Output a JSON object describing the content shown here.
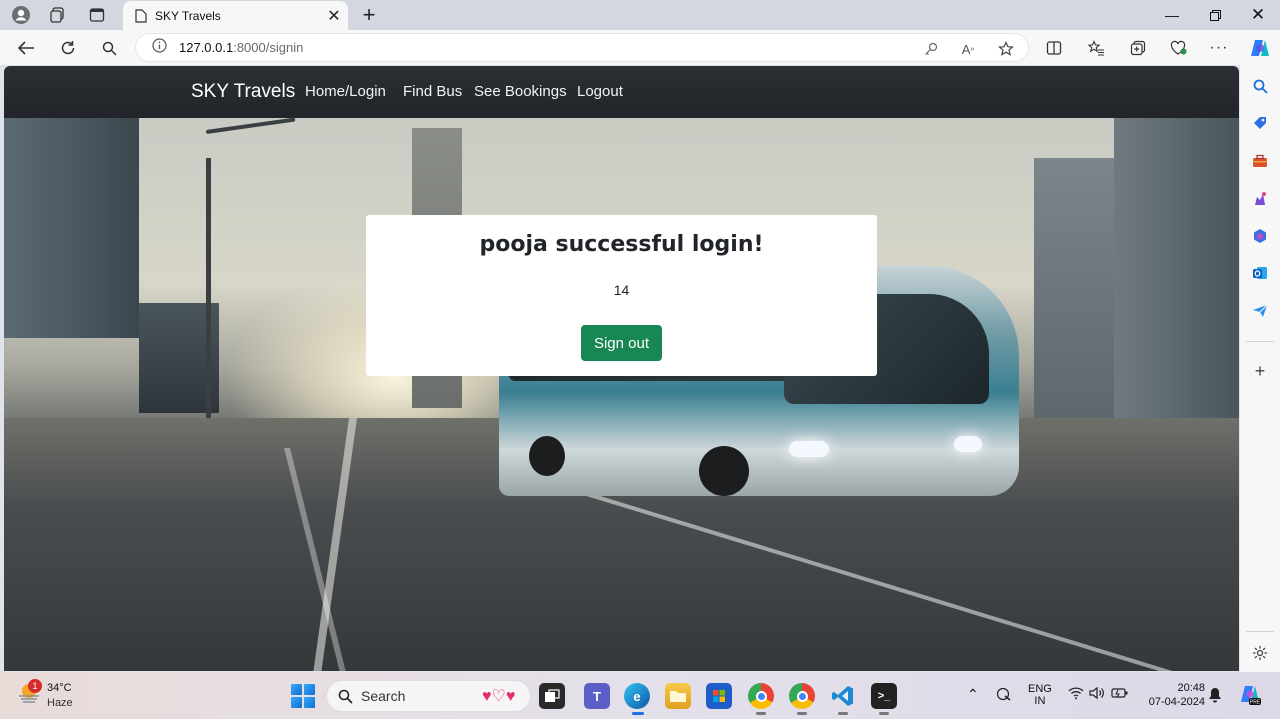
{
  "browser": {
    "tab_title": "SKY Travels",
    "url_host": "127.0.0.1",
    "url_path": ":8000/signin"
  },
  "site": {
    "brand": "SKY Travels",
    "nav": [
      "Home/Login",
      "Find Bus",
      "See Bookings",
      "Logout"
    ]
  },
  "card": {
    "title": "pooja successful login!",
    "number": "14",
    "button": "Sign out"
  },
  "taskbar": {
    "temperature": "34°C",
    "weather": "Haze",
    "weather_badge": "1",
    "search": "Search",
    "lang_top": "ENG",
    "lang_bottom": "IN",
    "time": "20:48",
    "date": "07-04-2024"
  },
  "colors": {
    "navbar": "#212529",
    "success_button": "#198754"
  }
}
